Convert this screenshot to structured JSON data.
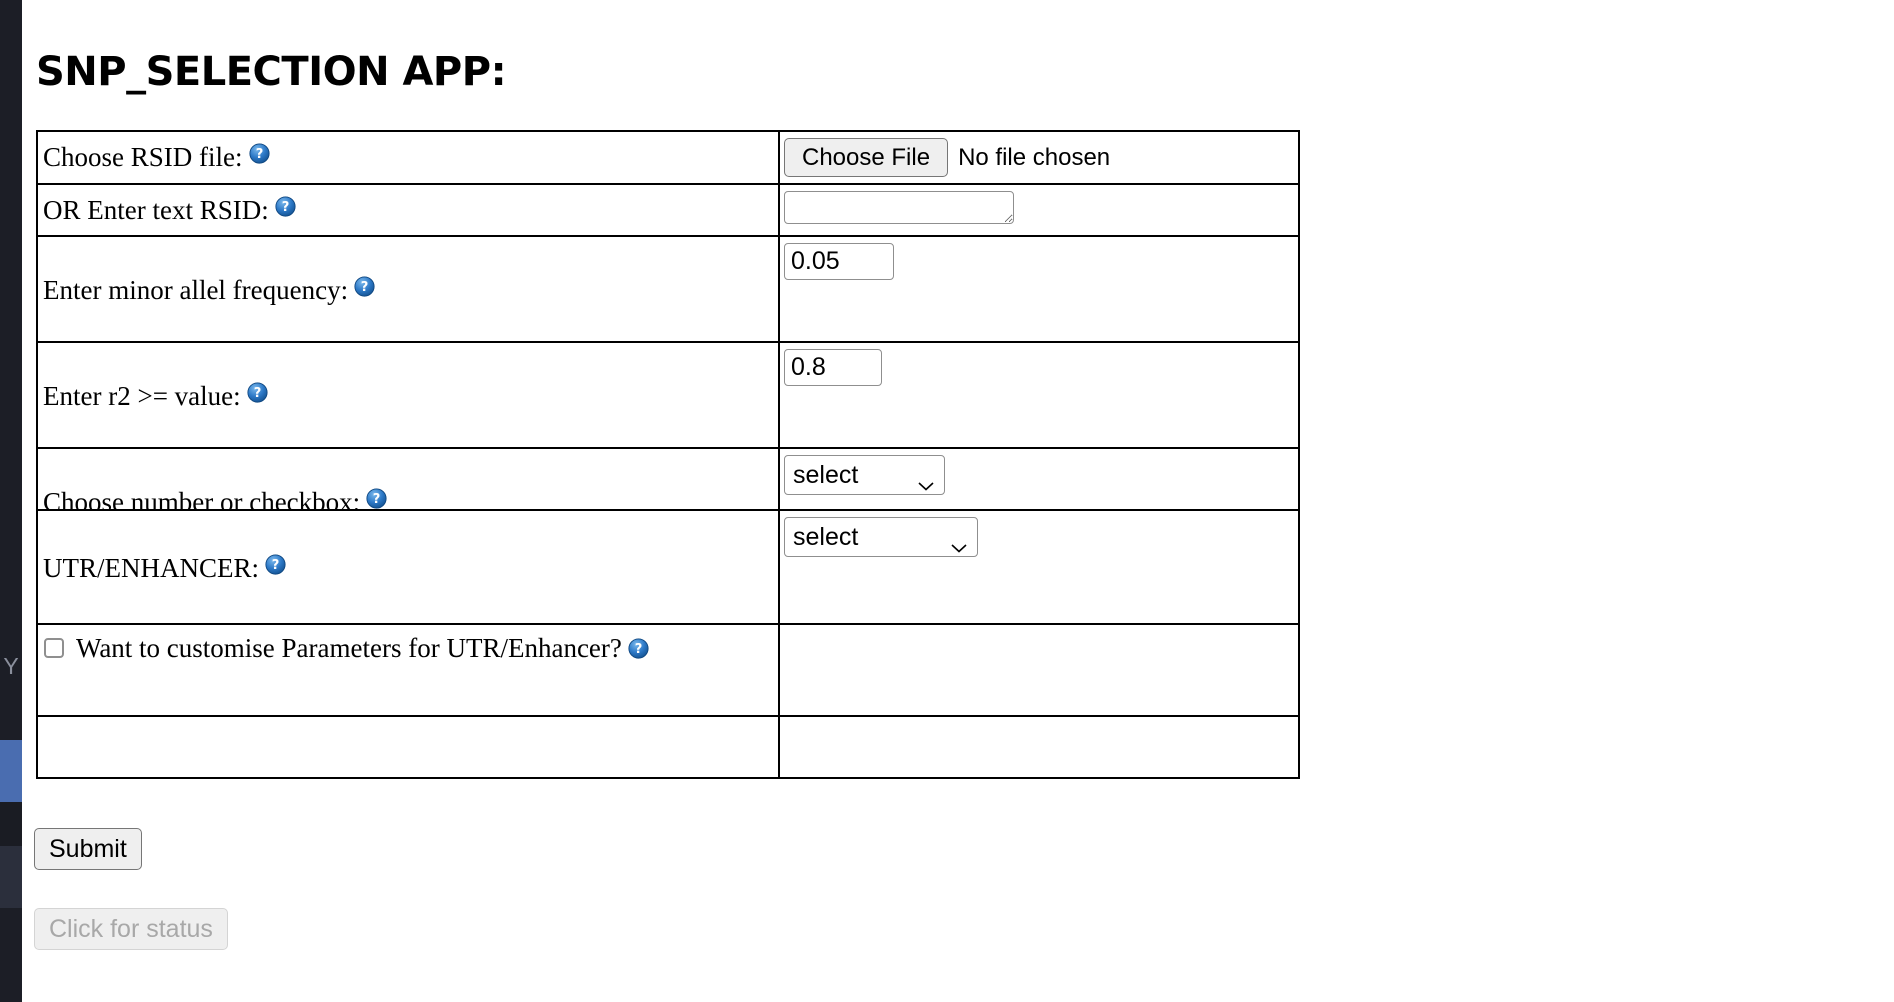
{
  "app": {
    "title": "SNP_SELECTION APP:"
  },
  "sidebar_strip": {
    "visible_letter": "Y"
  },
  "icons": {
    "help": "help-question-badge-icon",
    "chevron": "chevron-down-icon"
  },
  "form": {
    "rows": [
      {
        "label": "Choose RSID file:",
        "control": "file",
        "button_label": "Choose File",
        "file_status": "No file chosen"
      },
      {
        "label": "OR Enter text RSID:",
        "control": "textarea",
        "value": "",
        "placeholder": ""
      },
      {
        "label": "Enter minor allel frequency:",
        "control": "number",
        "value": "0.05"
      },
      {
        "label": "Enter r2 >= value:",
        "control": "number",
        "value": "0.8"
      },
      {
        "label": "Choose number or checkbox:",
        "control": "select",
        "value": "select"
      }
    ],
    "extra_rows": [
      {
        "label": "UTR/ENHANCER:",
        "control": "select",
        "value": "select"
      },
      {
        "label": "Want to customise Parameters for UTR/Enhancer?",
        "control": "checkbox",
        "checked": false
      }
    ]
  },
  "buttons": {
    "submit": "Submit",
    "status": "Click for status"
  },
  "colors": {
    "help_badge_outer": "#1c5fad",
    "help_badge_inner": "#4f9be0",
    "sidebar_dark": "#1c1e26",
    "sidebar_active": "#4a6db0",
    "border": "#000000",
    "control_border": "#8f8f8f",
    "button_face": "#efefef",
    "disabled_text": "#a8a8a8"
  }
}
